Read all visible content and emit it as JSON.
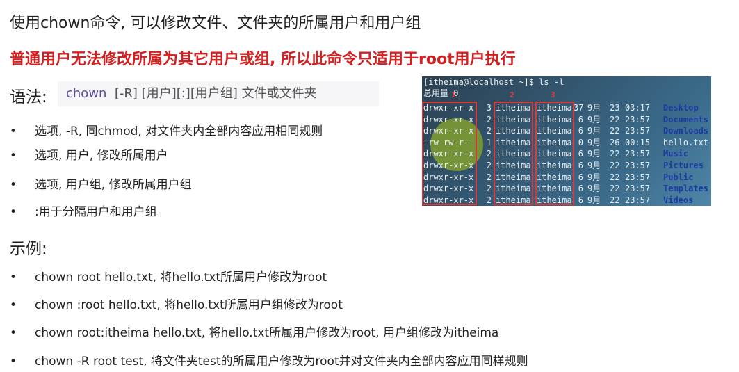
{
  "title": "使用chown命令, 可以修改文件、文件夹的所属用户和用户组",
  "warning": "普通用户无法修改所属为其它用户或组, 所以此命令只适用于root用户执行",
  "syntax": {
    "label": "语法:",
    "command": "chown",
    "args": "[-R] [用户][:][用户组] 文件或文件夹"
  },
  "options": [
    "选项, -R, 同chmod, 对文件夹内全部内容应用相同规则",
    "选项, 用户, 修改所属用户",
    "选项, 用户组, 修改所属用户组",
    ":用于分隔用户和用户组"
  ],
  "examples_label": "示例:",
  "examples": [
    "chown root hello.txt, 将hello.txt所属用户修改为root",
    "chown :root hello.txt, 将hello.txt所属用户组修改为root",
    "chown root:itheima hello.txt, 将hello.txt所属用户修改为root, 用户组修改为itheima",
    "chown -R root test, 将文件夹test的所属用户修改为root并对文件夹内全部内容应用同样规则"
  ],
  "terminal": {
    "prompt": "[itheima@localhost ~]$ ls -l",
    "total": "总用量 0",
    "labels": [
      "1",
      "2",
      "3"
    ],
    "rows": [
      {
        "perm": "drwxr-xr-x.",
        "links": "3",
        "user": "itheima",
        "group": "itheima",
        "size": "37",
        "month": "9月",
        "day": "23",
        "time": "03:17",
        "name": "Desktop",
        "dir": true
      },
      {
        "perm": "drwxr-xr-x.",
        "links": "2",
        "user": "itheima",
        "group": "itheima",
        "size": "6",
        "month": "9月",
        "day": "22",
        "time": "23:57",
        "name": "Documents",
        "dir": true
      },
      {
        "perm": "drwxr-xr-x.",
        "links": "2",
        "user": "itheima",
        "group": "itheima",
        "size": "6",
        "month": "9月",
        "day": "22",
        "time": "23:57",
        "name": "Downloads",
        "dir": true
      },
      {
        "perm": "-rw-rw-r--.",
        "links": "1",
        "user": "itheima",
        "group": "itheima",
        "size": "0",
        "month": "9月",
        "day": "26",
        "time": "00:15",
        "name": "hello.txt",
        "dir": false
      },
      {
        "perm": "drwxr-xr-x.",
        "links": "2",
        "user": "itheima",
        "group": "itheima",
        "size": "6",
        "month": "9月",
        "day": "22",
        "time": "23:57",
        "name": "Music",
        "dir": true
      },
      {
        "perm": "drwxr-xr-x.",
        "links": "2",
        "user": "itheima",
        "group": "itheima",
        "size": "6",
        "month": "9月",
        "day": "22",
        "time": "23:57",
        "name": "Pictures",
        "dir": true
      },
      {
        "perm": "drwxr-xr-x.",
        "links": "2",
        "user": "itheima",
        "group": "itheima",
        "size": "6",
        "month": "9月",
        "day": "22",
        "time": "23:57",
        "name": "Public",
        "dir": true
      },
      {
        "perm": "drwxr-xr-x.",
        "links": "2",
        "user": "itheima",
        "group": "itheima",
        "size": "6",
        "month": "9月",
        "day": "22",
        "time": "23:57",
        "name": "Templates",
        "dir": true
      },
      {
        "perm": "drwxr-xr-x.",
        "links": "2",
        "user": "itheima",
        "group": "itheima",
        "size": "6",
        "month": "9月",
        "day": "22",
        "time": "23:57",
        "name": "Videos",
        "dir": true
      }
    ]
  },
  "colors": {
    "warning": "#d42020",
    "box": "#d83a3a",
    "command": "#5b4a9e"
  }
}
